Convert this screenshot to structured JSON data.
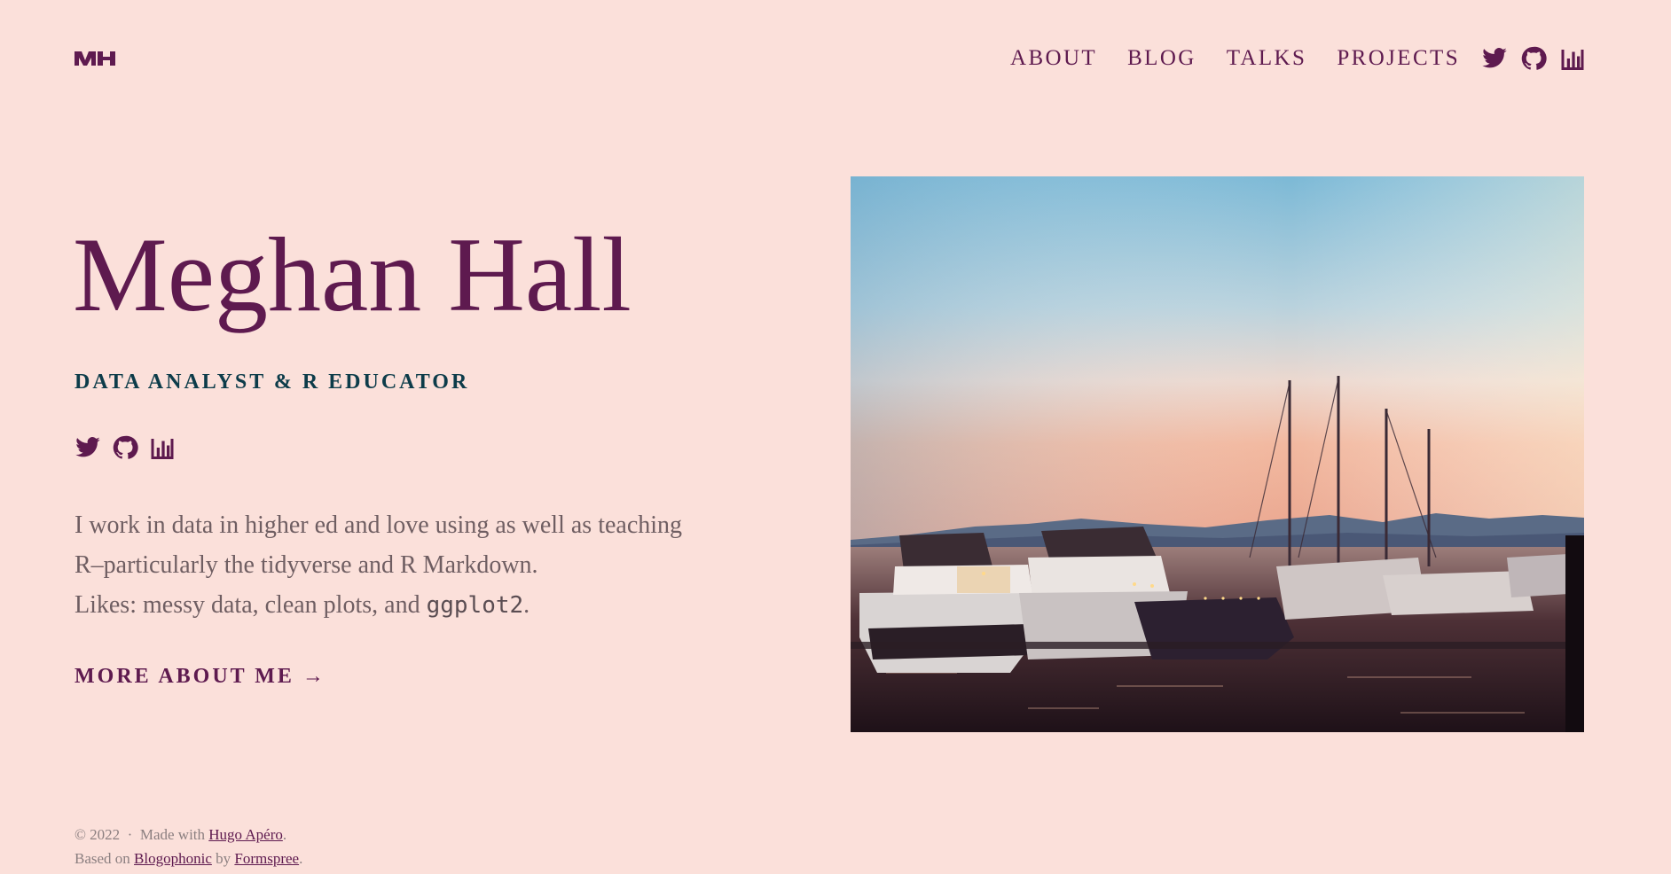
{
  "header": {
    "logo_alt": "MH",
    "nav": [
      {
        "label": "ABOUT"
      },
      {
        "label": "BLOG"
      },
      {
        "label": "TALKS"
      },
      {
        "label": "PROJECTS"
      }
    ],
    "icons": [
      "twitter-icon",
      "github-icon",
      "chart-icon"
    ]
  },
  "hero": {
    "title": "Meghan Hall",
    "subtitle": "DATA ANALYST & R EDUCATOR",
    "social_icons": [
      "twitter-icon",
      "github-icon",
      "chart-icon"
    ],
    "text_line1": "I work in data in higher ed and love using as well as teaching",
    "text_line2": "R–particularly the tidyverse and R Markdown.",
    "text_line3_prefix": "Likes: messy data, clean plots, and ",
    "text_line3_code": "ggplot2",
    "text_line3_suffix": ".",
    "more_link": "MORE ABOUT ME →"
  },
  "photo": {
    "alt": "Harbor at sunset"
  },
  "footer": {
    "copyright": "© 2022",
    "separator": "·",
    "made_with": "Made with",
    "hugo_link": "Hugo Apéro",
    "period1": ".",
    "based_on": "Based on",
    "blogophonic_link": "Blogophonic",
    "by": "by",
    "formspree_link": "Formspree",
    "period2": "."
  },
  "colors": {
    "background": "#fbe0da",
    "primary": "#5e1a4f",
    "subtitle": "#0d3c4a",
    "body_text": "#6f5e62"
  }
}
